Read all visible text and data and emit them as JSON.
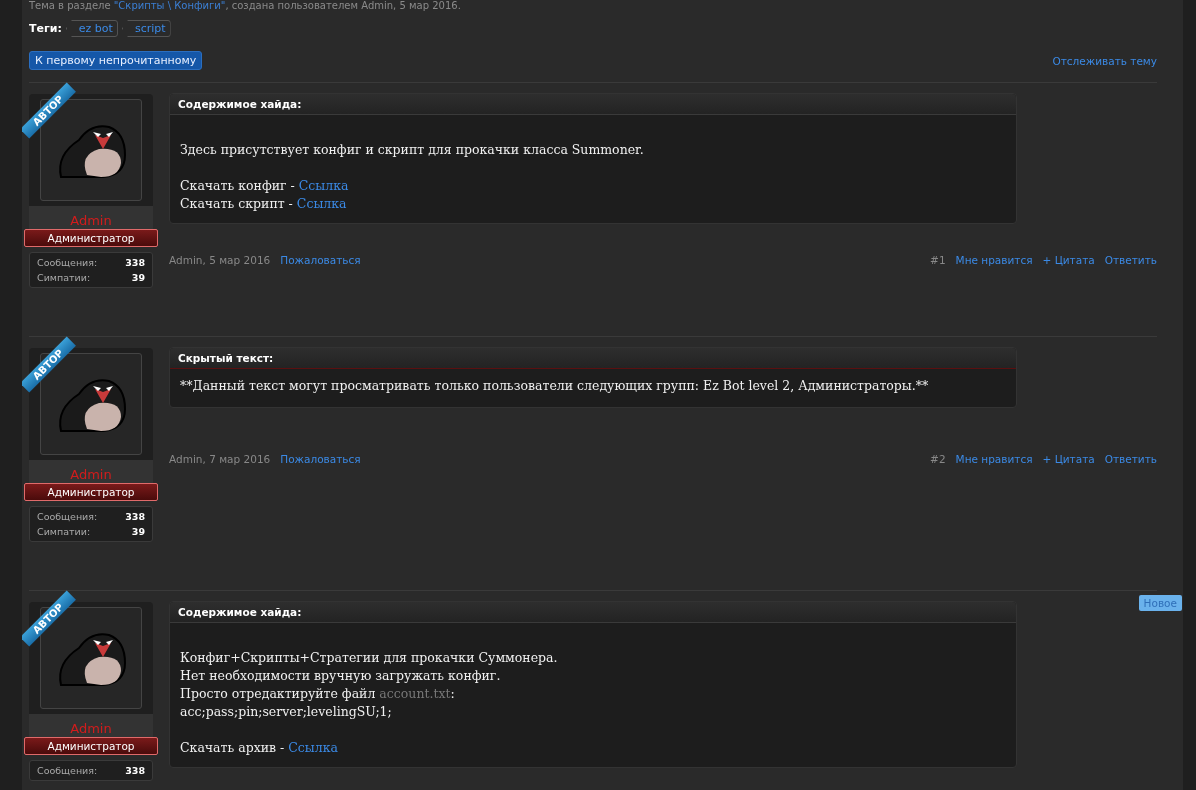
{
  "thread_info": [
    {
      "text": "Тема в разделе ",
      "kind": "plain"
    },
    {
      "text": "\"Скрипты \\ Конфиги\"",
      "kind": "link"
    },
    {
      "text": ", создана пользователем Admin, 5 мар 2016.",
      "kind": "plain"
    }
  ],
  "tags": {
    "label": "Теги:",
    "items": [
      "ez bot",
      "script"
    ]
  },
  "first_unread_button": "К первому непрочитанному",
  "watch_link": "Отслеживать тему",
  "posts": [
    {
      "ribbon": "АВТОР",
      "author": "Admin",
      "role": "Администратор",
      "stats": [
        {
          "label": "Сообщения:",
          "value": "338"
        },
        {
          "label": "Симпатии:",
          "value": "39"
        }
      ],
      "block": {
        "title": "Содержимое хайда:",
        "kind": "hide",
        "paragraphs": [
          [
            [
              {
                "text": "Здесь присутствует конфиг и скрипт для прокачки класса Summoner.",
                "kind": "plain"
              }
            ]
          ],
          [
            [
              {
                "text": "Скачать конфиг - ",
                "kind": "plain"
              },
              {
                "text": "Ссылка",
                "kind": "link"
              }
            ],
            [
              {
                "text": "Скачать скрипт - ",
                "kind": "plain"
              },
              {
                "text": "Ссылка",
                "kind": "link"
              }
            ]
          ]
        ]
      },
      "meta": {
        "date": "Admin, 5 мар 2016",
        "report": "Пожаловаться",
        "number": "#1",
        "actions": [
          "Мне нравится",
          "+ Цитата",
          "Ответить"
        ]
      }
    },
    {
      "ribbon": "АВТОР",
      "author": "Admin",
      "role": "Администратор",
      "stats": [
        {
          "label": "Сообщения:",
          "value": "338"
        },
        {
          "label": "Симпатии:",
          "value": "39"
        }
      ],
      "block": {
        "title": "Скрытый текст:",
        "kind": "hidden",
        "paragraphs": [
          [
            [
              {
                "text": "**Данный текст могут просматривать только пользователи следующих групп: Ez Bot level 2, Администраторы.**",
                "kind": "plain"
              }
            ]
          ]
        ]
      },
      "meta": {
        "date": "Admin, 7 мар 2016",
        "report": "Пожаловаться",
        "number": "#2",
        "actions": [
          "Мне нравится",
          "+ Цитата",
          "Ответить"
        ]
      }
    },
    {
      "ribbon": "АВТОР",
      "author": "Admin",
      "role": "Администратор",
      "stats": [
        {
          "label": "Сообщения:",
          "value": "338"
        }
      ],
      "new_label": "Новое",
      "block": {
        "title": "Содержимое хайда:",
        "kind": "hide",
        "paragraphs": [
          [
            [
              {
                "text": "Конфиг+Скрипты+Стратегии для прокачки Суммонера.",
                "kind": "plain"
              }
            ],
            [
              {
                "text": "Нет необходимости вручную загружать конфиг.",
                "kind": "plain"
              }
            ],
            [
              {
                "text": "Просто отредактируйте файл ",
                "kind": "plain"
              },
              {
                "text": "account.txt",
                "kind": "muted"
              },
              {
                "text": ":",
                "kind": "plain"
              }
            ],
            [
              {
                "text": "acc;pass;pin;server;levelingSU;1;",
                "kind": "plain"
              }
            ]
          ],
          [
            [
              {
                "text": "Скачать архив - ",
                "kind": "plain"
              },
              {
                "text": "Ссылка",
                "kind": "link"
              }
            ]
          ]
        ]
      }
    }
  ]
}
